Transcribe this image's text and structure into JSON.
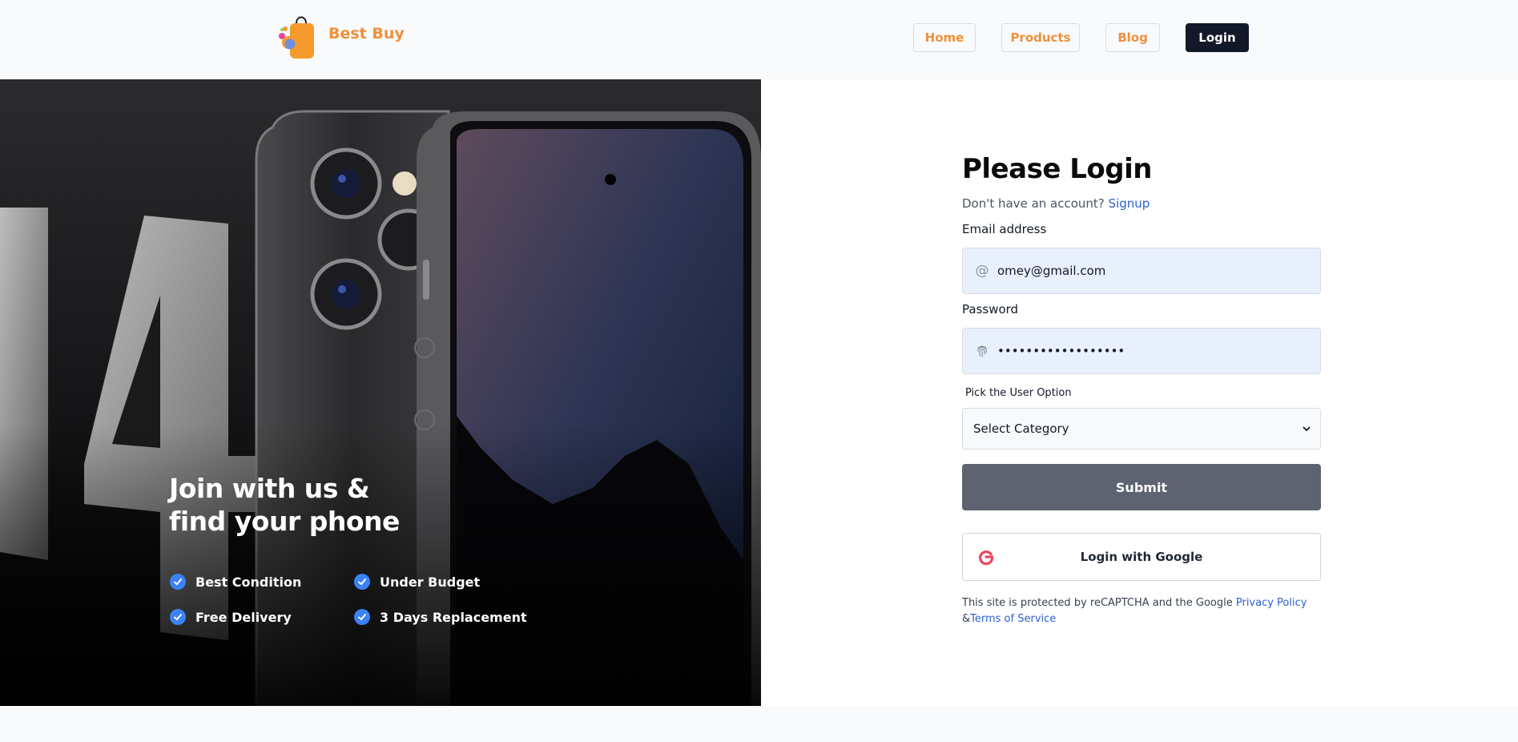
{
  "brand": {
    "name": "Best Buy",
    "accent_color": "#f0903a",
    "logo_icon": "shopping-bag-icon"
  },
  "nav": {
    "home": "Home",
    "products": "Products",
    "blog": "Blog",
    "login": "Login"
  },
  "hero": {
    "title_line1": "Join with us &",
    "title_line2": "find your phone",
    "image_caption": "14",
    "features": [
      "Best Condition",
      "Under Budget",
      "Free Delivery",
      "3 Days Replacement"
    ],
    "feature_icon": "check-circle-icon",
    "feature_icon_color": "#3b82f6"
  },
  "login_form": {
    "title": "Please Login",
    "signup_prompt": "Don't have an account?",
    "signup_link": "Signup",
    "email_label": "Email address",
    "email_value": "omey@gmail.com",
    "email_icon": "at-icon",
    "password_label": "Password",
    "password_value": "••••••••••••••••••",
    "password_icon": "fingerprint-icon",
    "user_option_label": "Pick the User Option",
    "category_selected": "Select Category",
    "submit_label": "Submit",
    "google_label": "Login with Google",
    "google_icon": "google-icon",
    "legal_text": "This site is protected by reCAPTCHA and the Google",
    "privacy_link": "Privacy Policy",
    "ampersand": "&",
    "terms_link": "Terms of Service",
    "link_color": "#2f5fd0"
  }
}
